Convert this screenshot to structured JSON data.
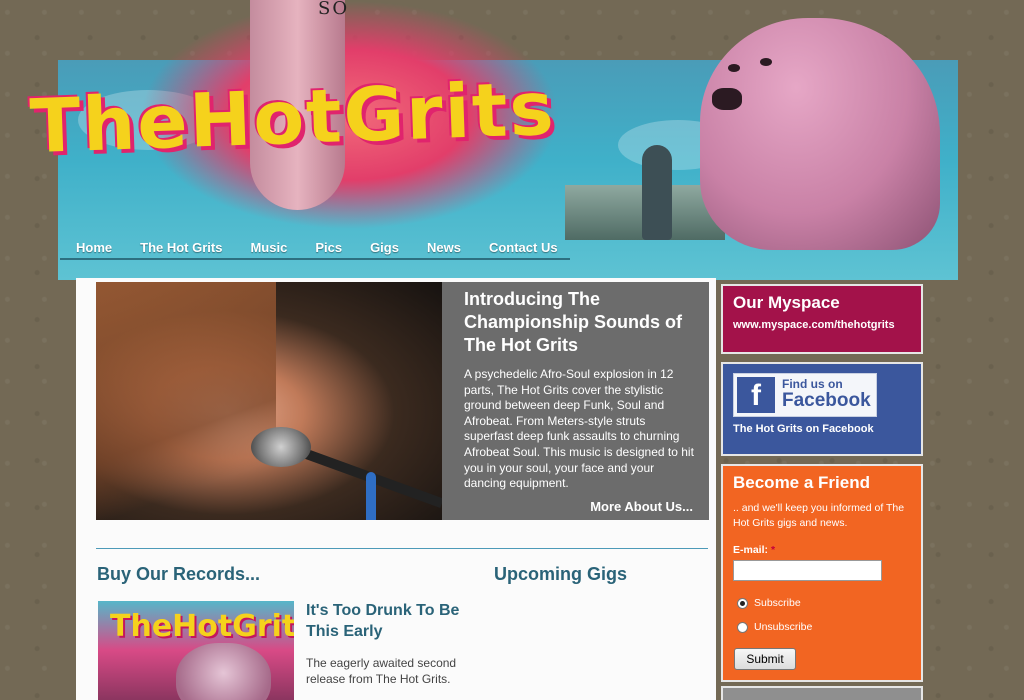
{
  "site": {
    "logo_text": "TheHotGrits",
    "tattoo": "SO"
  },
  "nav": {
    "items": [
      "Home",
      "The Hot Grits",
      "Music",
      "Pics",
      "Gigs",
      "News",
      "Contact Us"
    ]
  },
  "feature": {
    "title": "Introducing The Championship Sounds of The Hot Grits",
    "body": "A psychedelic Afro-Soul explosion in 12 parts, The Hot Grits cover the stylistic ground between deep Funk, Soul and Afrobeat. From Meters-style struts superfast deep funk assaults to churning Afrobeat Soul. This music is designed to hit you in your soul, your face and your dancing equipment.",
    "more_link": "More About Us..."
  },
  "records": {
    "heading": "Buy Our Records...",
    "album_logo": "TheHotGrits",
    "title": "It's Too Drunk To Be This Early",
    "description": "The eagerly awaited second release from The Hot Grits."
  },
  "gigs": {
    "heading": "Upcoming Gigs"
  },
  "myspace": {
    "title": "Our Myspace",
    "url": "www.myspace.com/thehotgrits"
  },
  "facebook": {
    "badge_f": "f",
    "badge_find": "Find us on",
    "badge_name": "Facebook",
    "link": "The Hot Grits on Facebook"
  },
  "friend": {
    "title": "Become a Friend",
    "description": ".. and we'll keep you informed of The Hot Grits gigs and news.",
    "email_label": "E-mail:",
    "required_mark": "*",
    "email_value": "",
    "subscribe_label": "Subscribe",
    "unsubscribe_label": "Unsubscribe",
    "submit_label": "Submit",
    "selected": "subscribe"
  },
  "colors": {
    "myspace": "#a3124a",
    "facebook": "#3b579d",
    "friend": "#f26522",
    "heading": "#2a6378",
    "feature_bg": "#6c6c6c"
  }
}
